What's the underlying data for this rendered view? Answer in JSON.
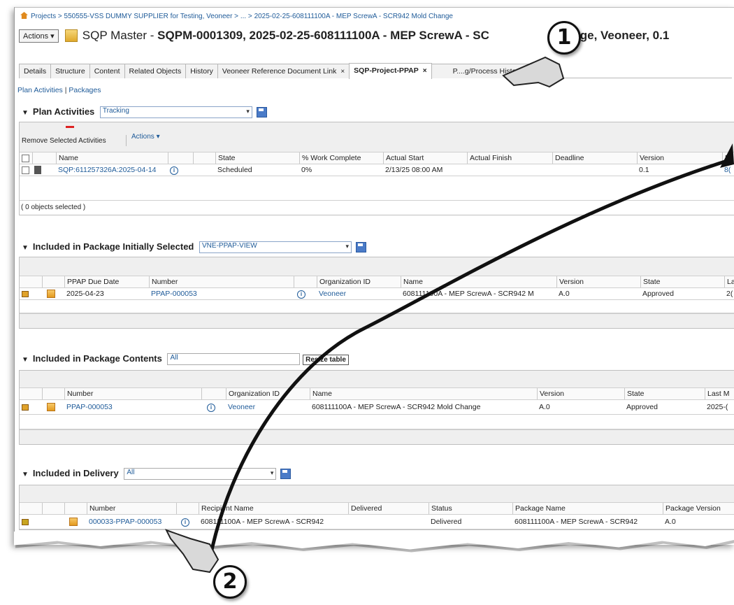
{
  "breadcrumb": {
    "items": [
      "Projects",
      "550555-VSS DUMMY SUPPLIER for Testing, Veoneer",
      "...",
      "2025-02-25-608111100A - MEP ScrewA - SCR942 Mold Change"
    ],
    "separator": " > "
  },
  "title": {
    "actions_label": "Actions ▾",
    "prefix": "SQP Master - ",
    "name": "SQPM-0001309, 2025-02-25-608111100A -  MEP ScrewA - SC",
    "suffix": "ange, Veoneer, 0.1"
  },
  "tabs": [
    {
      "label": "Details"
    },
    {
      "label": "Structure"
    },
    {
      "label": "Content"
    },
    {
      "label": "Related Objects"
    },
    {
      "label": "History"
    },
    {
      "label": "Veoneer Reference Document Link",
      "close": "×"
    },
    {
      "label": "SQP-Project-PPAP",
      "close": "×",
      "active": true
    },
    {
      "label": "P....g/Process History",
      "close": "×"
    },
    {
      "label": "+"
    }
  ],
  "subnav": {
    "plan_activities": "Plan Activities",
    "separator": "|",
    "packages": "Packages"
  },
  "plan_activities": {
    "title": "Plan Activities",
    "view": "Tracking",
    "remove_label": "Remove Selected Activities",
    "actions_label": "Actions ▾",
    "columns": [
      "Name",
      "State",
      "% Work Complete",
      "Actual Start",
      "Actual Finish",
      "Deadline",
      "Version",
      "P"
    ],
    "row": {
      "name": "SQP:611257326A:2025-04-14",
      "state": "Scheduled",
      "work": "0%",
      "start": "2/13/25 08:00 AM",
      "finish": "",
      "deadline": "",
      "version": "0.1",
      "p": "8("
    },
    "status": "( 0 objects selected )"
  },
  "package_initial": {
    "title": "Included in Package Initially Selected",
    "view": "VNE-PPAP-VIEW",
    "columns": [
      "PPAP Due Date",
      "Number",
      "Organization ID",
      "Name",
      "Version",
      "State",
      "La"
    ],
    "row": {
      "due": "2025-04-23",
      "number": "PPAP-000053",
      "org": "Veoneer",
      "name": "608111100A -  MEP ScrewA - SCR942 M",
      "version": "A.0",
      "state": "Approved",
      "last": "2("
    }
  },
  "package_contents": {
    "title": "Included in Package Contents",
    "view": "All",
    "resize_label": "Resize table",
    "columns": [
      "Number",
      "Organization ID",
      "Name",
      "Version",
      "State",
      "Last M"
    ],
    "row": {
      "number": "PPAP-000053",
      "org": "Veoneer",
      "name": "608111100A -  MEP ScrewA - SCR942 Mold Change",
      "version": "A.0",
      "state": "Approved",
      "last": "2025-("
    }
  },
  "delivery": {
    "title": "Included in Delivery",
    "view": "All",
    "columns": [
      "Number",
      "Recipient Name",
      "Delivered",
      "Status",
      "Package Name",
      "Package Version"
    ],
    "row": {
      "number": "000033-PPAP-000053",
      "recipient": "608111100A -  MEP ScrewA - SCR942",
      "delivered": "",
      "status": "Delivered",
      "package": "608111100A -  MEP ScrewA - SCR942",
      "pversion": "A.0"
    }
  },
  "callouts": {
    "one": "1",
    "two": "2"
  }
}
